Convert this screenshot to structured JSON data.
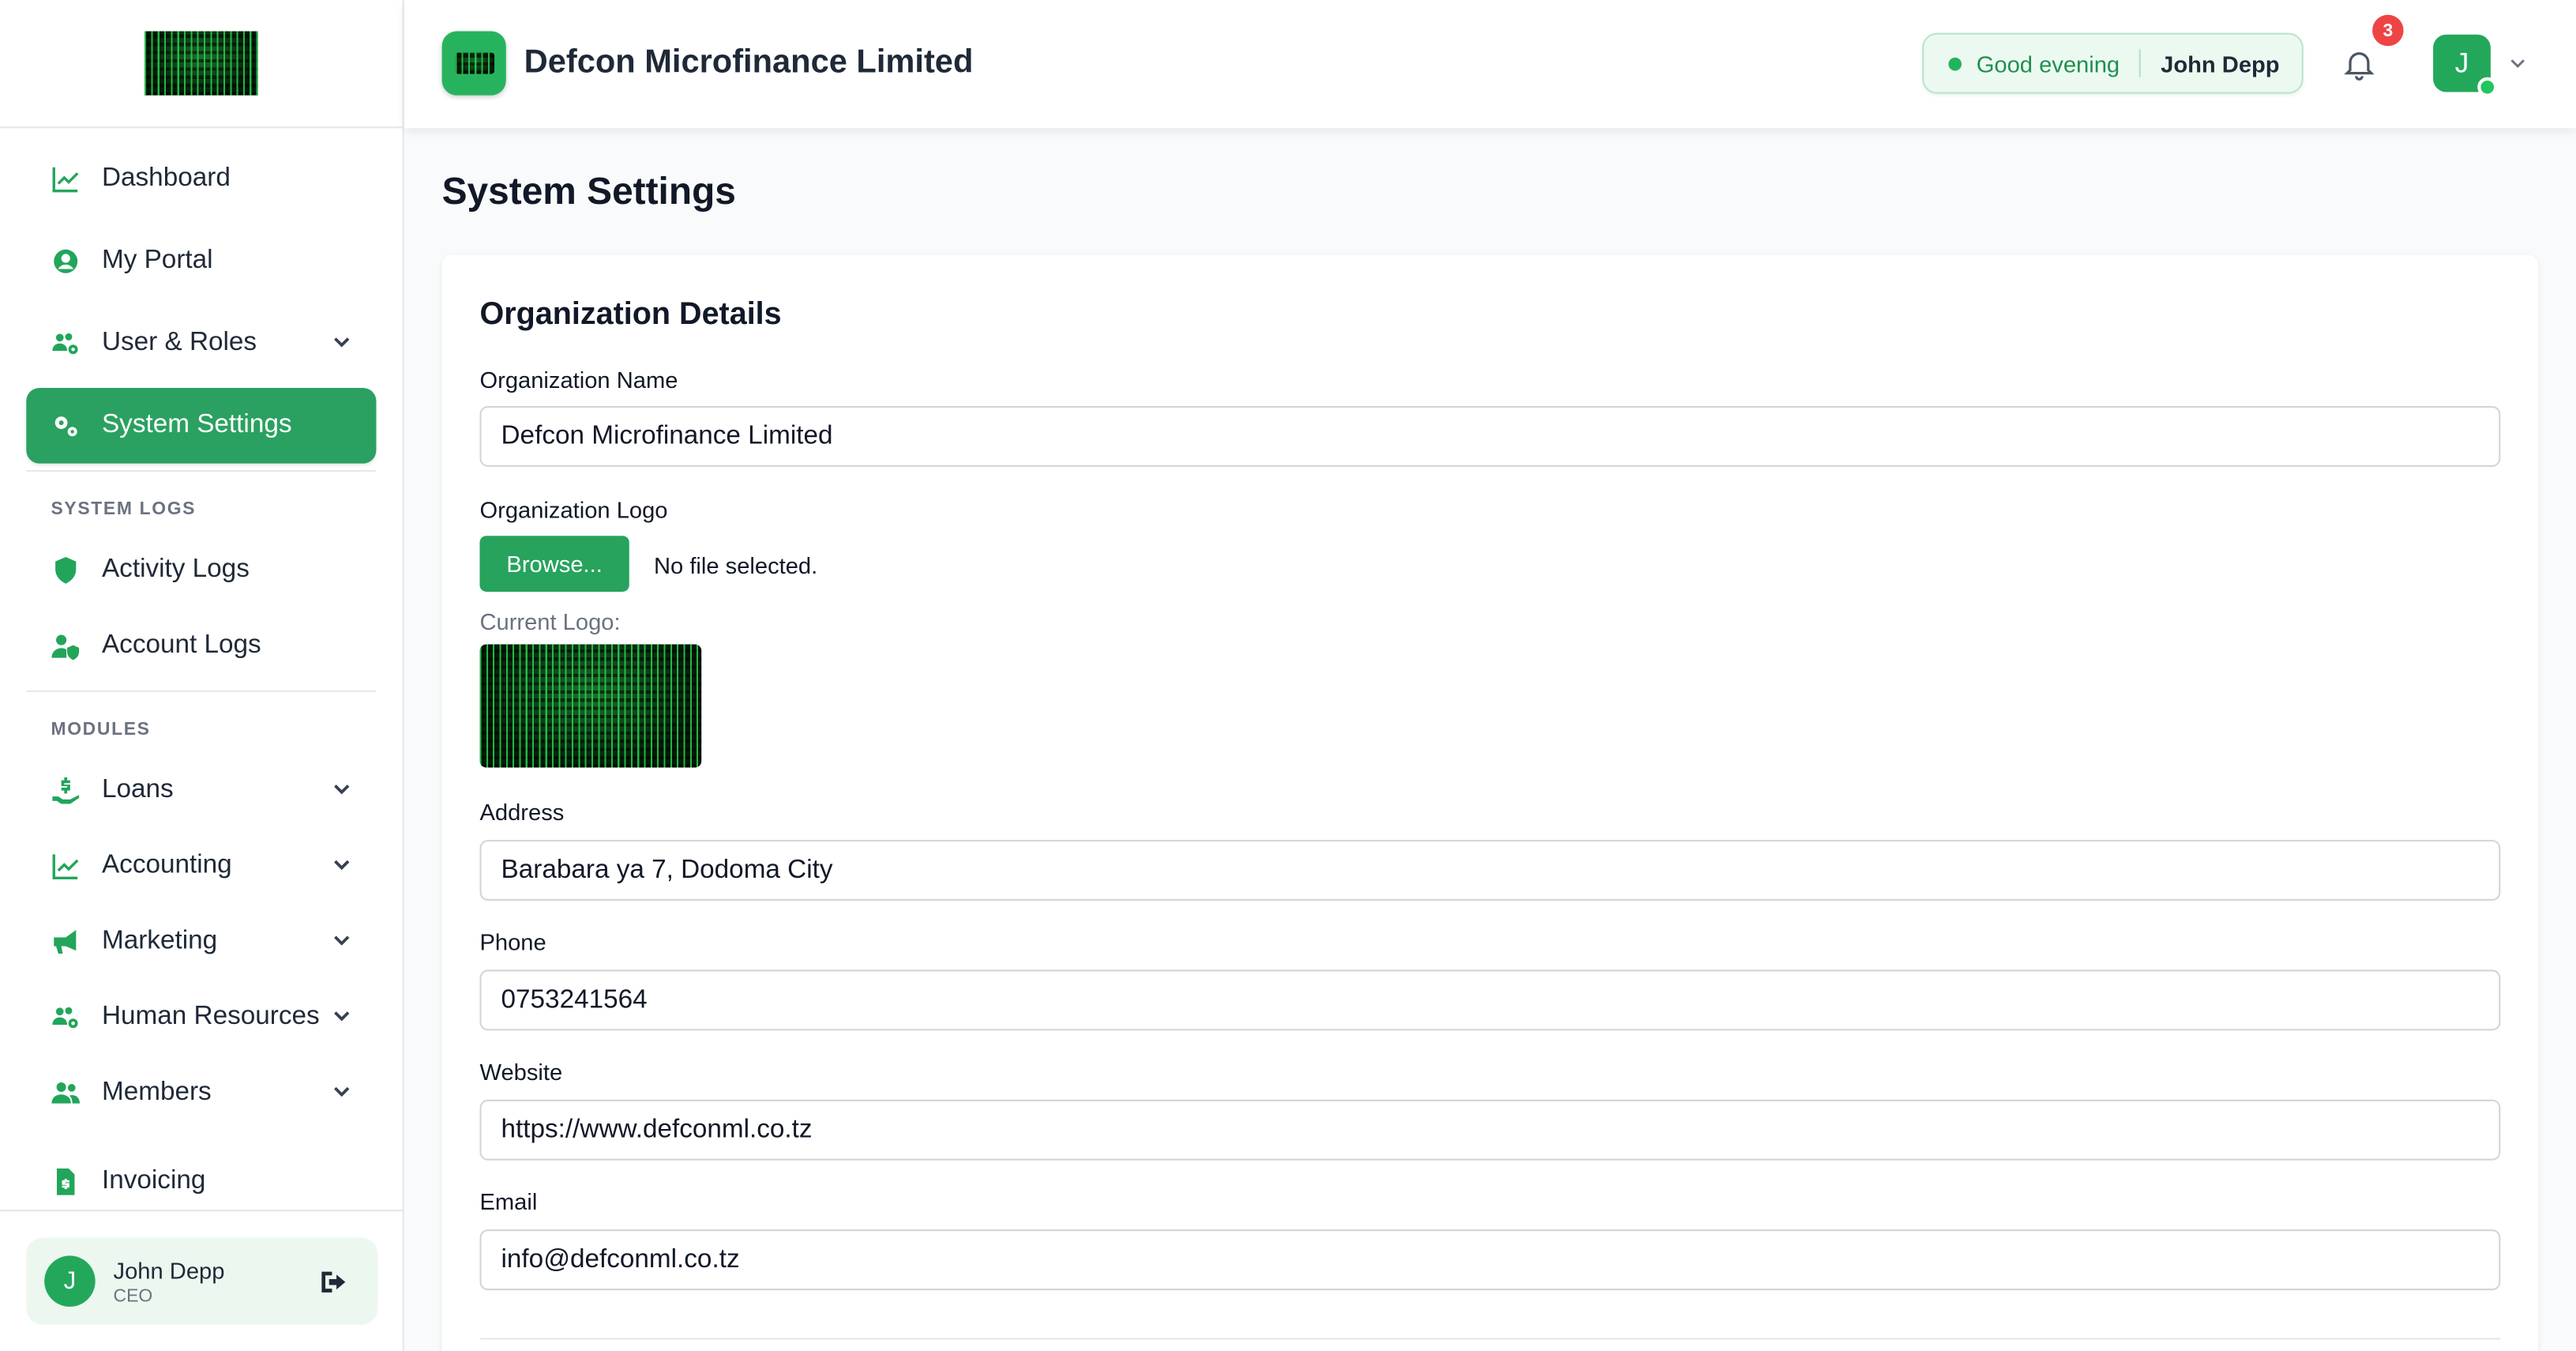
{
  "app": {
    "brand_title": "Defcon Microfinance Limited",
    "accent": "#2aa160"
  },
  "header": {
    "greeting": "Good evening",
    "user_name": "John Depp",
    "notification_count": "3",
    "avatar_initial": "J"
  },
  "sidebar": {
    "items_top": [
      {
        "label": "Dashboard",
        "icon": "chart-line-icon"
      },
      {
        "label": "My Portal",
        "icon": "user-circle-icon"
      },
      {
        "label": "User & Roles",
        "icon": "users-cog-icon",
        "has_submenu": true
      },
      {
        "label": "System Settings",
        "icon": "cogs-icon",
        "active": true
      }
    ],
    "system_logs_title": "SYSTEM LOGS",
    "system_logs": [
      {
        "label": "Activity Logs",
        "icon": "shield-icon"
      },
      {
        "label": "Account Logs",
        "icon": "user-shield-icon"
      }
    ],
    "modules_title": "MODULES",
    "modules": [
      {
        "label": "Loans",
        "icon": "hand-holding-dollar-icon",
        "has_submenu": true
      },
      {
        "label": "Accounting",
        "icon": "chart-line-icon",
        "has_submenu": true
      },
      {
        "label": "Marketing",
        "icon": "bullhorn-icon",
        "has_submenu": true
      },
      {
        "label": "Human Resources",
        "icon": "users-cog-icon",
        "has_submenu": true
      },
      {
        "label": "Members",
        "icon": "users-icon",
        "has_submenu": true
      },
      {
        "label": "Invoicing",
        "icon": "file-invoice-dollar-icon"
      }
    ],
    "user": {
      "initial": "J",
      "name": "John Depp",
      "role": "CEO"
    }
  },
  "main": {
    "page_title": "System Settings",
    "section_title": "Organization Details",
    "fields": {
      "org_name_label": "Organization Name",
      "org_name_value": "Defcon Microfinance Limited",
      "org_logo_label": "Organization Logo",
      "browse_label": "Browse...",
      "no_file_text": "No file selected.",
      "current_logo_label": "Current Logo:",
      "address_label": "Address",
      "address_value": "Barabara ya 7, Dodoma City",
      "phone_label": "Phone",
      "phone_value": "0753241564",
      "website_label": "Website",
      "website_value": "https://www.defconml.co.tz",
      "email_label": "Email",
      "email_value": "info@defconml.co.tz"
    }
  }
}
